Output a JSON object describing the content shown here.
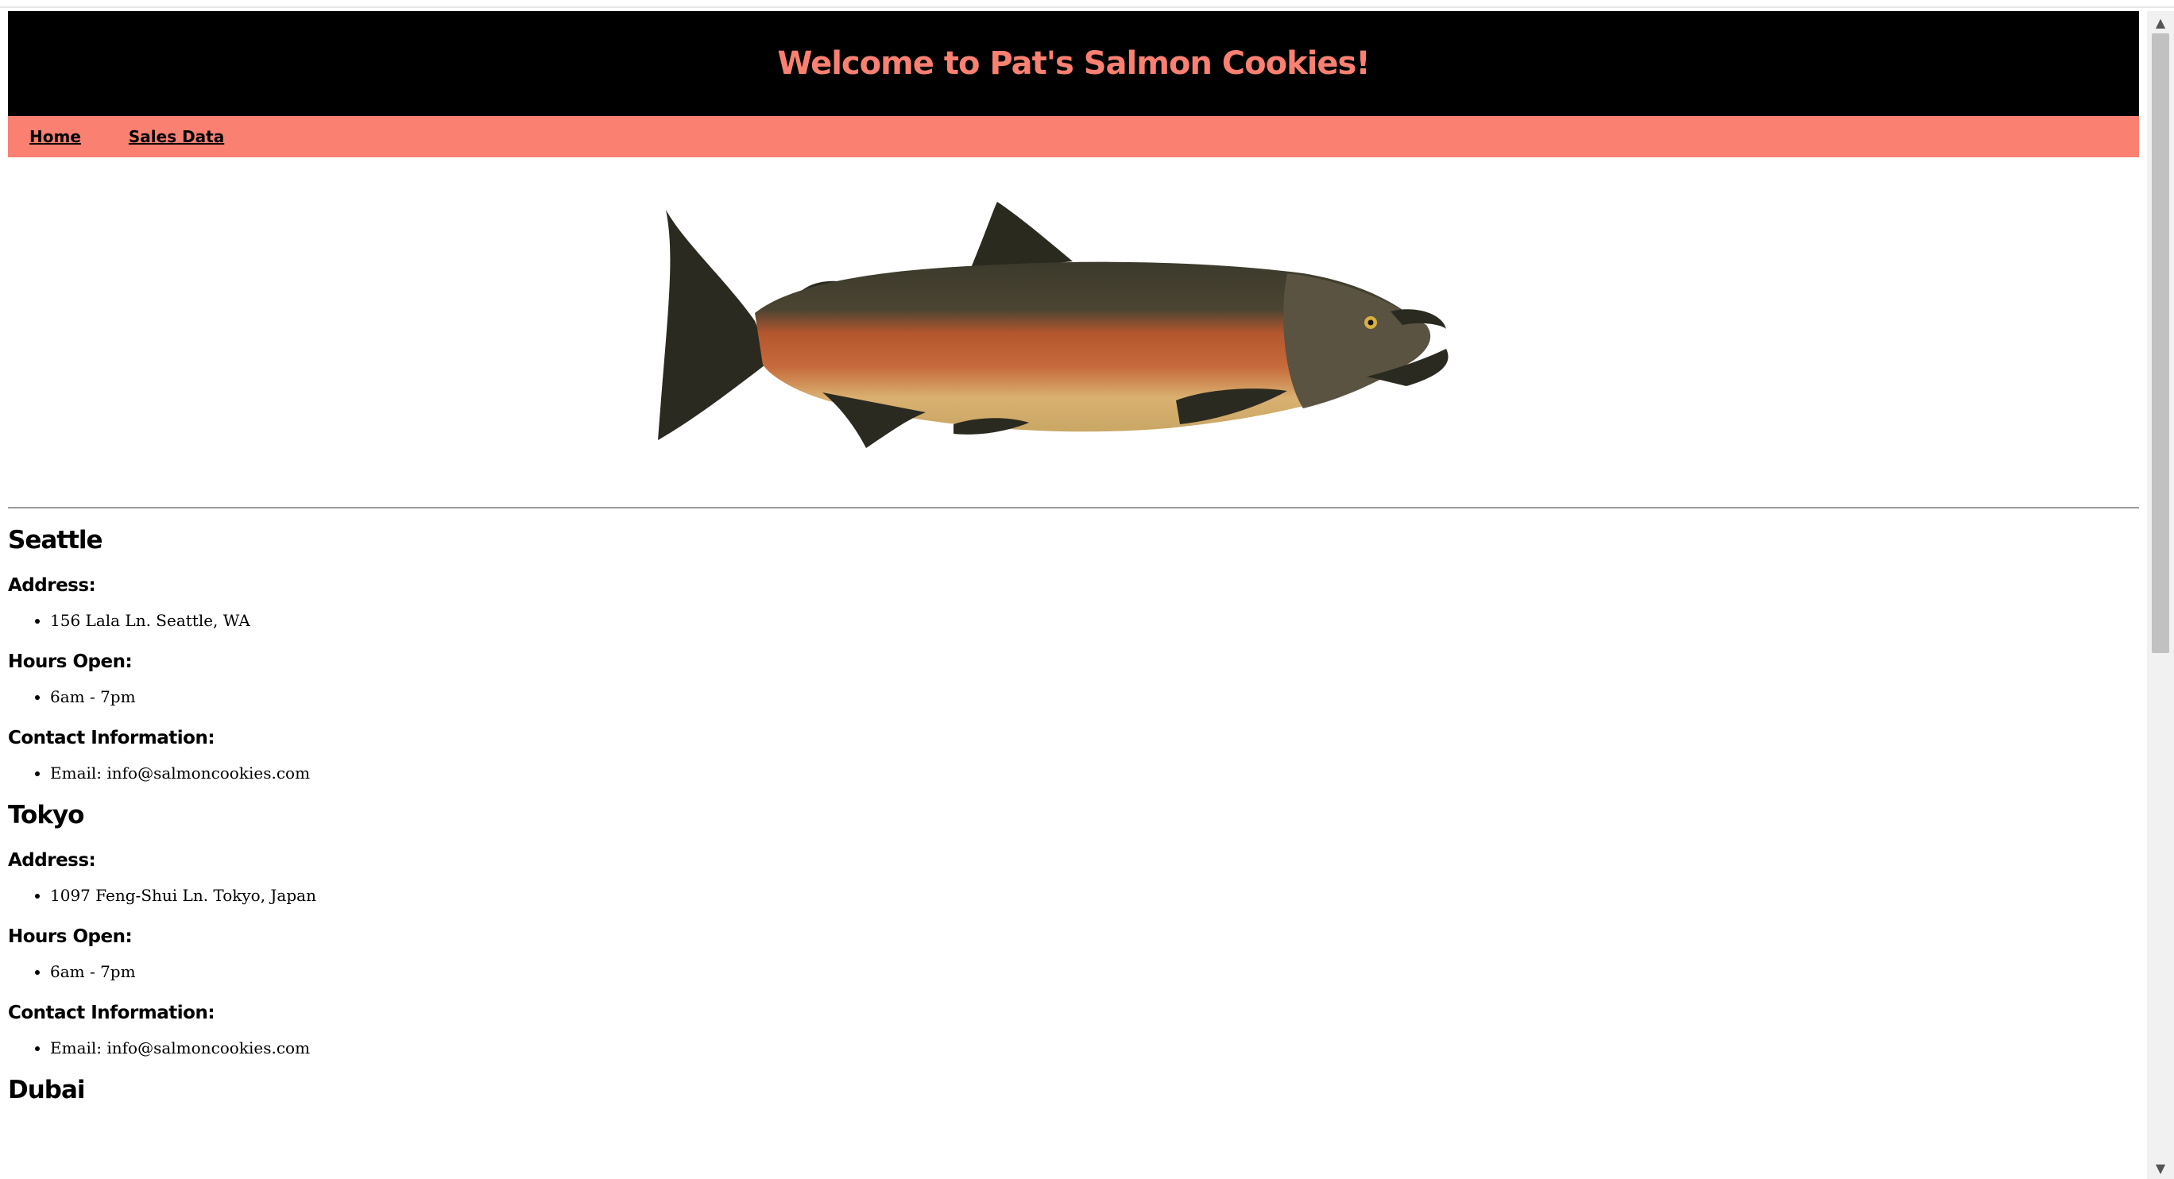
{
  "header": {
    "title": "Welcome to Pat's Salmon Cookies!"
  },
  "nav": {
    "items": [
      {
        "label": "Home"
      },
      {
        "label": "Sales Data"
      }
    ]
  },
  "hero": {
    "image": "salmon-fish"
  },
  "locations": [
    {
      "name": "Seattle",
      "address_heading": "Address:",
      "address": "156 Lala Ln. Seattle, WA",
      "hours_heading": "Hours Open:",
      "hours": "6am - 7pm",
      "contact_heading": "Contact Information:",
      "contact": "Email: info@salmoncookies.com"
    },
    {
      "name": "Tokyo",
      "address_heading": "Address:",
      "address": "1097 Feng-Shui Ln. Tokyo, Japan",
      "hours_heading": "Hours Open:",
      "hours": "6am - 7pm",
      "contact_heading": "Contact Information:",
      "contact": "Email: info@salmoncookies.com"
    },
    {
      "name": "Dubai"
    }
  ],
  "colors": {
    "accent": "#fa8072",
    "banner_bg": "#000000"
  }
}
